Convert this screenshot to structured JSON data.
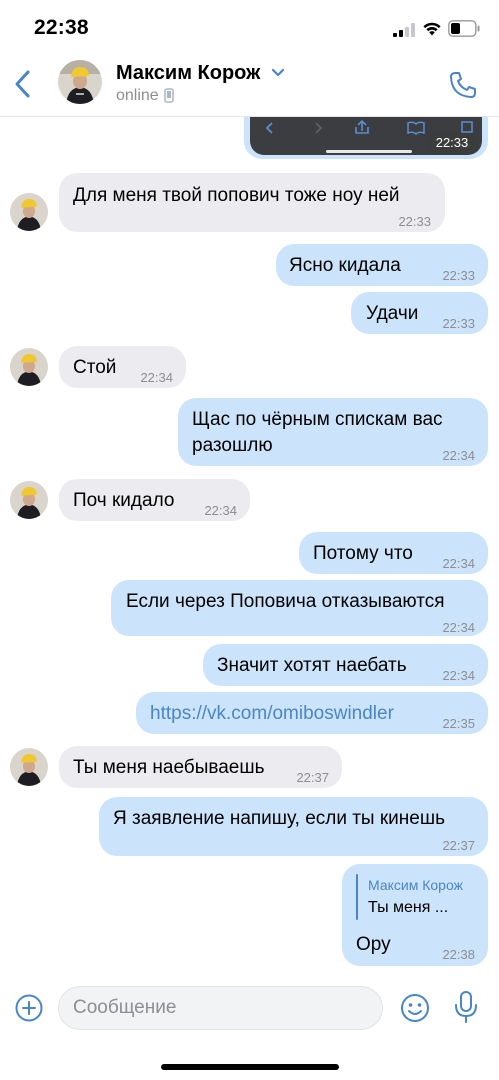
{
  "status_bar": {
    "time": "22:38"
  },
  "header": {
    "contact_name": "Максим Корож",
    "status": "online",
    "icons": [
      "back-arrow-icon",
      "chevron-down-icon",
      "mobile-phone-icon",
      "phone-call-icon"
    ]
  },
  "screenshot_message": {
    "time": "22:33"
  },
  "messages": [
    {
      "direction": "in",
      "text": "Для меня твой попович тоже ноу ней",
      "time": "22:33"
    },
    {
      "direction": "out",
      "text": "Ясно кидала",
      "time": "22:33"
    },
    {
      "direction": "out",
      "text": "Удачи",
      "time": "22:33"
    },
    {
      "direction": "in",
      "text": "Стой",
      "time": "22:34"
    },
    {
      "direction": "out",
      "text_line1": "Щас по чёрным спискам вас",
      "text_line2": "разошлю",
      "time": "22:34"
    },
    {
      "direction": "in",
      "text": "Поч кидало",
      "time": "22:34"
    },
    {
      "direction": "out",
      "text": "Потому что",
      "time": "22:34"
    },
    {
      "direction": "out",
      "text": "Если через Поповича отказываются",
      "time": "22:34"
    },
    {
      "direction": "out",
      "text": "Значит хотят наебать",
      "time": "22:34"
    },
    {
      "direction": "out",
      "text": "https://vk.com/omiboswindler",
      "time": "22:35"
    },
    {
      "direction": "in",
      "text": "Ты меня наебываешь",
      "time": "22:37"
    },
    {
      "direction": "out",
      "text": "Я заявление напишу, если ты кинешь",
      "time": "22:37"
    },
    {
      "direction": "out",
      "reply_author": "Максим Корож",
      "reply_snippet": "Ты меня ...",
      "text": "Ору",
      "time": "22:38"
    }
  ],
  "composer": {
    "placeholder": "Сообщение",
    "value": "",
    "icons": [
      "plus-circle-icon",
      "smile-icon",
      "microphone-icon"
    ]
  },
  "colors": {
    "accent": "#4a86c5",
    "incoming_bubble": "#ececf0",
    "outgoing_bubble": "#cce4fb",
    "time_text": "#8d8d92"
  }
}
